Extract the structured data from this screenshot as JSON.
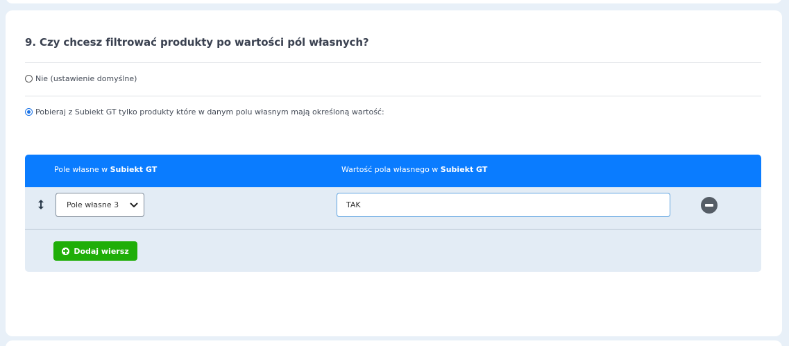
{
  "question": {
    "title": "9. Czy chcesz filtrować produkty po wartości pól własnych?"
  },
  "options": [
    {
      "label": "Nie (ustawienie domyślne)",
      "checked": false
    },
    {
      "label": "Pobieraj z Subiekt GT tylko produkty które w danym polu własnym mają określoną wartość:",
      "checked": true
    }
  ],
  "table": {
    "col1_prefix": "Pole własne w ",
    "col1_bold": "Subiekt GT",
    "col2_prefix": "Wartość pola własnego w ",
    "col2_bold": "Subiekt GT",
    "rows": [
      {
        "field": "Pole własne 3",
        "value": "TAK"
      }
    ],
    "add_button": "Dodaj wiersz"
  },
  "colors": {
    "header": "#0a7cff",
    "add_button": "#1fae08",
    "table_bg": "#e3ecf5"
  },
  "icons": [
    "drag-handle-icon",
    "chevron-down-icon",
    "remove-row-icon",
    "plus-circle-icon"
  ]
}
